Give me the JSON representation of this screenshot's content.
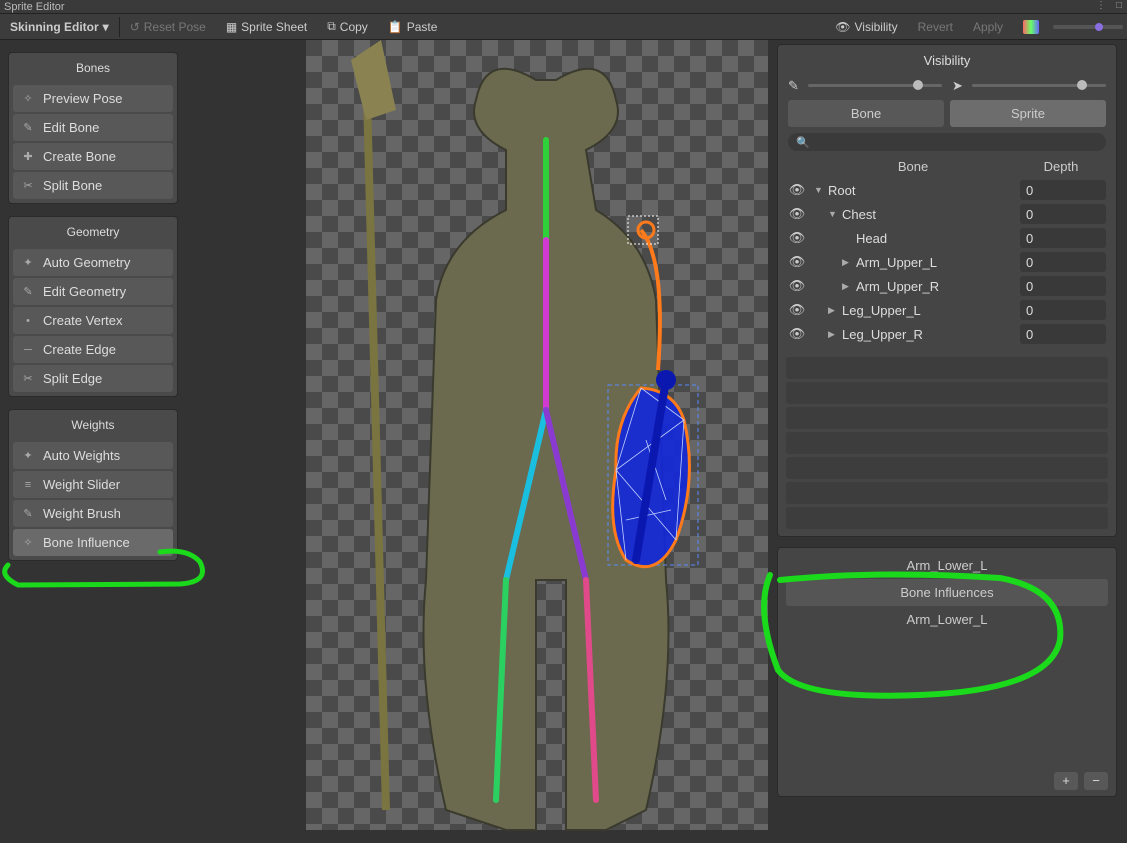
{
  "window": {
    "title": "Sprite Editor"
  },
  "toolbar": {
    "mode_label": "Skinning Editor",
    "reset_label": "Reset Pose",
    "spritesheet_label": "Sprite Sheet",
    "copy_label": "Copy",
    "paste_label": "Paste",
    "visibility_label": "Visibility",
    "revert_label": "Revert",
    "apply_label": "Apply"
  },
  "tool_groups": {
    "bones": {
      "header": "Bones",
      "buttons": [
        {
          "id": "preview-pose",
          "label": "Preview Pose"
        },
        {
          "id": "edit-bone",
          "label": "Edit Bone"
        },
        {
          "id": "create-bone",
          "label": "Create Bone"
        },
        {
          "id": "split-bone",
          "label": "Split Bone"
        }
      ]
    },
    "geometry": {
      "header": "Geometry",
      "buttons": [
        {
          "id": "auto-geometry",
          "label": "Auto Geometry"
        },
        {
          "id": "edit-geometry",
          "label": "Edit Geometry"
        },
        {
          "id": "create-vertex",
          "label": "Create Vertex"
        },
        {
          "id": "create-edge",
          "label": "Create Edge"
        },
        {
          "id": "split-edge",
          "label": "Split Edge"
        }
      ]
    },
    "weights": {
      "header": "Weights",
      "buttons": [
        {
          "id": "auto-weights",
          "label": "Auto Weights"
        },
        {
          "id": "weight-slider",
          "label": "Weight Slider"
        },
        {
          "id": "weight-brush",
          "label": "Weight Brush"
        },
        {
          "id": "bone-influence",
          "label": "Bone Influence",
          "active": true
        }
      ]
    }
  },
  "visibility_panel": {
    "title": "Visibility",
    "tab_bone": "Bone",
    "tab_sprite": "Sprite",
    "col_bone": "Bone",
    "col_depth": "Depth",
    "bones": [
      {
        "name": "Root",
        "depth": "0",
        "indent": 0,
        "expand": "down"
      },
      {
        "name": "Chest",
        "depth": "0",
        "indent": 1,
        "expand": "down"
      },
      {
        "name": "Head",
        "depth": "0",
        "indent": 2,
        "expand": "none"
      },
      {
        "name": "Arm_Upper_L",
        "depth": "0",
        "indent": 2,
        "expand": "right"
      },
      {
        "name": "Arm_Upper_R",
        "depth": "0",
        "indent": 2,
        "expand": "right"
      },
      {
        "name": "Leg_Upper_L",
        "depth": "0",
        "indent": 1,
        "expand": "right"
      },
      {
        "name": "Leg_Upper_R",
        "depth": "0",
        "indent": 1,
        "expand": "right"
      }
    ]
  },
  "influence_panel": {
    "selected": "Arm_Lower_L",
    "sub_header": "Bone Influences",
    "item": "Arm_Lower_L"
  }
}
